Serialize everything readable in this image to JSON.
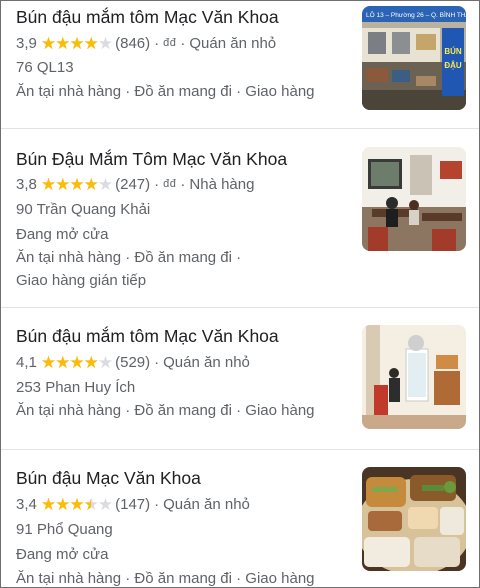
{
  "places": [
    {
      "name": "Bún đậu mắm tôm Mạc Văn Khoa",
      "rating": "3,9",
      "stars": 3.9,
      "reviews": "(846)",
      "price": "đđ",
      "category": "Quán ăn nhỏ",
      "address": "76 QL13",
      "status": "",
      "services": "Ăn tại nhà hàng · Đồ ăn mang đi · Giao hàng",
      "services_2": "",
      "photo_sign_1": "BÚN",
      "photo_sign_2": "ĐẬU",
      "photo_banner": "LÔ 13 – Phường 26 – Q. BÌNH THẠNH"
    },
    {
      "name": "Bún Đậu Mắm Tôm Mạc Văn Khoa",
      "rating": "3,8",
      "stars": 3.8,
      "reviews": "(247)",
      "price": "đđ",
      "category": "Nhà hàng",
      "address": "90 Trần Quang Khải",
      "status": "Đang mở cửa",
      "services": "Ăn tại nhà hàng · Đồ ăn mang đi ·",
      "services_2": "Giao hàng gián tiếp"
    },
    {
      "name": "Bún đậu mắm tôm Mạc Văn Khoa",
      "rating": "4,1",
      "stars": 4.1,
      "reviews": "(529)",
      "price": "",
      "category": "Quán ăn nhỏ",
      "address": "253 Phan Huy Ích",
      "status": "",
      "services": "Ăn tại nhà hàng · Đồ ăn mang đi · Giao hàng",
      "services_2": ""
    },
    {
      "name": "Bún đậu Mạc Văn Khoa",
      "rating": "3,4",
      "stars": 3.4,
      "reviews": "(147)",
      "price": "",
      "category": "Quán ăn nhỏ",
      "address": "91 Phổ Quang",
      "status": "Đang mở cửa",
      "services": "Ăn tại nhà hàng · Đồ ăn mang đi · Giao hàng",
      "services_2": ""
    }
  ],
  "colors": {
    "star": "#fbbc04",
    "star_empty": "#dadce0",
    "text": "#202124",
    "secondary": "#5f6368"
  },
  "icons": {
    "star": "star-icon"
  }
}
